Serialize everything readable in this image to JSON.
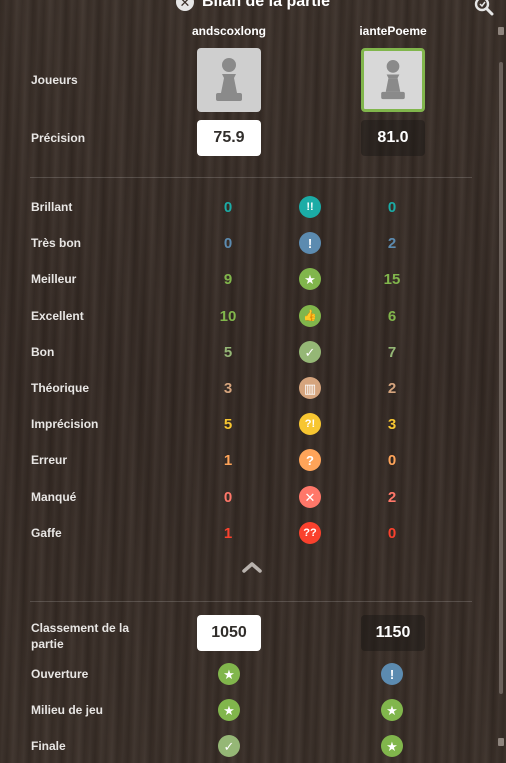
{
  "header": {
    "title": "Bilan de la partie"
  },
  "players": {
    "white": {
      "name": "andscoxlong",
      "precision": "75.9",
      "rating": "1050"
    },
    "black": {
      "name": "iantePoeme",
      "precision": "81.0",
      "rating": "1150"
    }
  },
  "labels": {
    "players": "Joueurs",
    "precision": "Précision",
    "game_rating_line1": "Classement de la",
    "game_rating_line2": "partie",
    "opening": "Ouverture",
    "middlegame": "Milieu de jeu",
    "endgame": "Finale"
  },
  "moves": [
    {
      "label": "Brillant",
      "white": "0",
      "black": "0",
      "icon": "brilliant-icon",
      "glyph": "!!",
      "color": "#1baca6"
    },
    {
      "label": "Très bon",
      "white": "0",
      "black": "2",
      "icon": "great-icon",
      "glyph": "!",
      "color": "#5c8bb0"
    },
    {
      "label": "Meilleur",
      "white": "9",
      "black": "15",
      "icon": "best-icon",
      "glyph": "★",
      "color": "#81b64c"
    },
    {
      "label": "Excellent",
      "white": "10",
      "black": "6",
      "icon": "excellent-icon",
      "glyph": "👍",
      "color": "#81b64c"
    },
    {
      "label": "Bon",
      "white": "5",
      "black": "7",
      "icon": "good-icon",
      "glyph": "✓",
      "color": "#95b776"
    },
    {
      "label": "Théorique",
      "white": "3",
      "black": "2",
      "icon": "book-icon",
      "glyph": "▥",
      "color": "#d5a47d"
    },
    {
      "label": "Imprécision",
      "white": "5",
      "black": "3",
      "icon": "inaccuracy-icon",
      "glyph": "?!",
      "color": "#f7c631"
    },
    {
      "label": "Erreur",
      "white": "1",
      "black": "0",
      "icon": "mistake-icon",
      "glyph": "?",
      "color": "#ffa459"
    },
    {
      "label": "Manqué",
      "white": "0",
      "black": "2",
      "icon": "miss-icon",
      "glyph": "✕",
      "color": "#ff7769"
    },
    {
      "label": "Gaffe",
      "white": "1",
      "black": "0",
      "icon": "blunder-icon",
      "glyph": "??",
      "color": "#fa412d"
    }
  ],
  "phases": {
    "opening": {
      "white": "best-icon",
      "black": "great-icon"
    },
    "middlegame": {
      "white": "best-icon",
      "black": "best-icon"
    },
    "endgame": {
      "white": "good-icon",
      "black": "best-icon"
    }
  }
}
